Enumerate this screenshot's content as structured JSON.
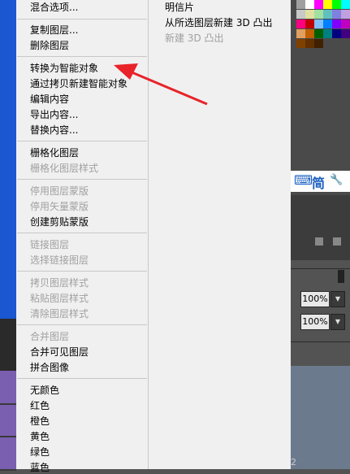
{
  "menu": {
    "items": [
      {
        "label": "混合选项...",
        "enabled": true
      },
      {
        "label": "复制图层...",
        "enabled": true
      },
      {
        "label": "删除图层",
        "enabled": true
      },
      {
        "label": "转换为智能对象",
        "enabled": true
      },
      {
        "label": "通过拷贝新建智能对象",
        "enabled": true
      },
      {
        "label": "编辑内容",
        "enabled": true
      },
      {
        "label": "导出内容...",
        "enabled": true
      },
      {
        "label": "替换内容...",
        "enabled": true
      },
      {
        "label": "栅格化图层",
        "enabled": true
      },
      {
        "label": "栅格化图层样式",
        "enabled": false
      },
      {
        "label": "停用图层蒙版",
        "enabled": false
      },
      {
        "label": "停用矢量蒙版",
        "enabled": false
      },
      {
        "label": "创建剪贴蒙版",
        "enabled": true
      },
      {
        "label": "链接图层",
        "enabled": false
      },
      {
        "label": "选择链接图层",
        "enabled": false
      },
      {
        "label": "拷贝图层样式",
        "enabled": false
      },
      {
        "label": "粘贴图层样式",
        "enabled": false
      },
      {
        "label": "清除图层样式",
        "enabled": false
      },
      {
        "label": "合并图层",
        "enabled": false
      },
      {
        "label": "合并可见图层",
        "enabled": true
      },
      {
        "label": "拼合图像",
        "enabled": true
      },
      {
        "label": "无颜色",
        "enabled": true
      },
      {
        "label": "红色",
        "enabled": true
      },
      {
        "label": "橙色",
        "enabled": true
      },
      {
        "label": "黄色",
        "enabled": true
      },
      {
        "label": "绿色",
        "enabled": true
      },
      {
        "label": "蓝色",
        "enabled": true
      }
    ]
  },
  "submenu": {
    "items": [
      {
        "label": "明信片",
        "enabled": true
      },
      {
        "label": "从所选图层新建 3D 凸出",
        "enabled": true
      },
      {
        "label": "新建 3D 凸出",
        "enabled": false
      }
    ]
  },
  "right_panel": {
    "ime": {
      "keyboard": "⌨",
      "simplified": "简",
      "tool": "🔧"
    },
    "opacity_value": "100%",
    "fill_value": "100%",
    "bottom_digit": "2"
  },
  "colors": {
    "menu_bg": "#f0f0f0",
    "disabled_text": "#a0a0a0",
    "arrow": "#e8232a",
    "left_blue": "#1a57d0",
    "purple": "#7a5fb0",
    "slate": "#6b7a8c"
  },
  "swatches": [
    "#a0a0a0",
    "#ffffff",
    "#ff00ff",
    "#ffff00",
    "#00ff00",
    "#00ffff",
    "#c8c8c8",
    "#e0e0a0",
    "#a0e0a0",
    "#60c0c0",
    "#8080e0",
    "#c0a0e0",
    "#ff0080",
    "#c00000",
    "#80c0ff",
    "#0080ff",
    "#8000ff",
    "#c000c0",
    "#e0a060",
    "#c06000",
    "#006000",
    "#008080",
    "#000080",
    "#400080",
    "#804000",
    "#603000",
    "#402000"
  ]
}
